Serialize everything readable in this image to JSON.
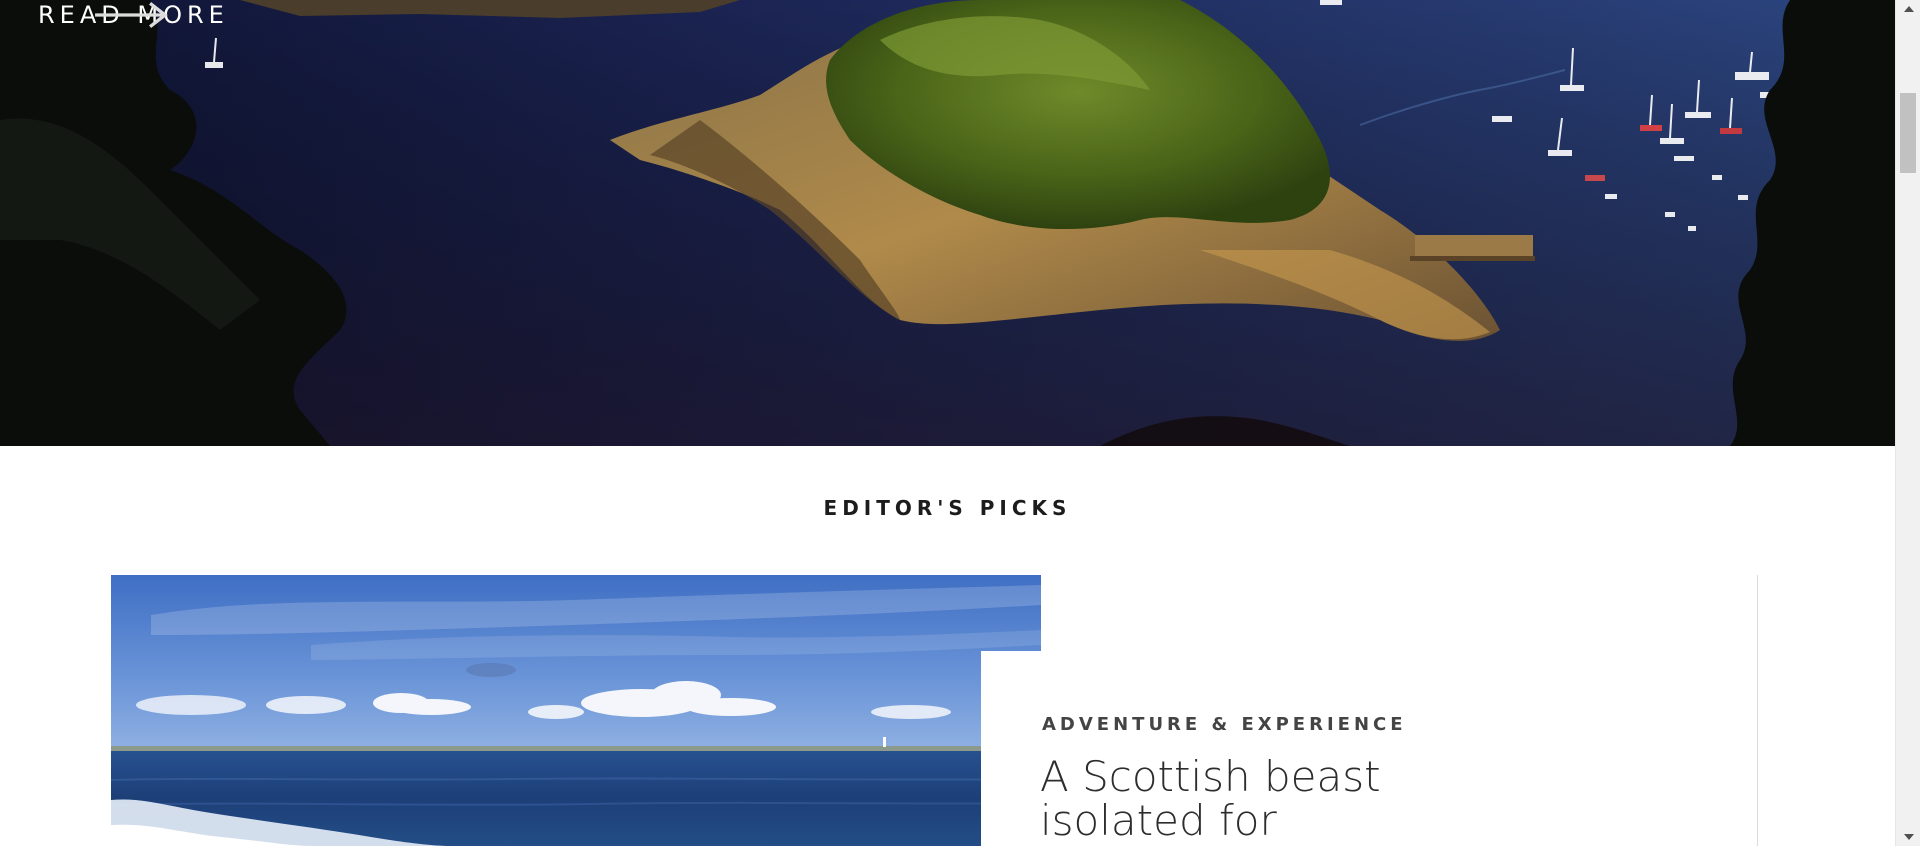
{
  "hero": {
    "read_more_label": "READ MORE"
  },
  "editors_picks": {
    "heading": "EDITOR'S PICKS",
    "featured": {
      "category": "ADVENTURE & EXPERIENCE",
      "title": "A Scottish beast isolated for"
    }
  },
  "icons": {
    "read_more_arrow": "arrow-right-icon",
    "scroll_up": "triangle-up-icon",
    "scroll_down": "triangle-down-icon"
  },
  "colors": {
    "sea": "#1b2350",
    "island_green": "#4f6b1c",
    "text_dark": "#1c1c1c",
    "category_gray": "#444444"
  }
}
